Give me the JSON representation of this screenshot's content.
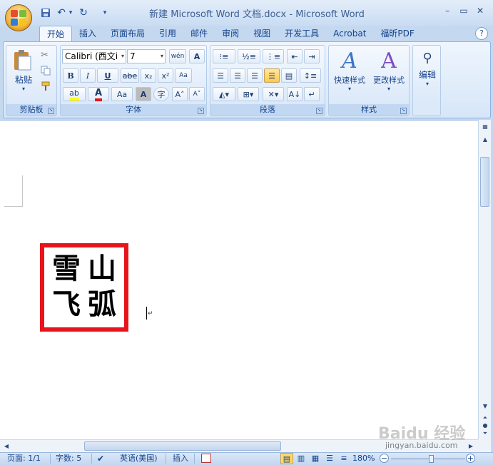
{
  "window": {
    "title": "新建 Microsoft Word 文档.docx - Microsoft Word",
    "minimize": "–",
    "maximize": "▭",
    "close": "✕"
  },
  "qat": {
    "save": "💾",
    "undo": "↶",
    "dropdown": "▾",
    "redo": "↻",
    "customize": "▾"
  },
  "tabs": [
    "开始",
    "插入",
    "页面布局",
    "引用",
    "邮件",
    "审阅",
    "视图",
    "开发工具",
    "Acrobat",
    "福昕PDF"
  ],
  "help": "?",
  "clipboard": {
    "paste_label": "粘贴",
    "group_label": "剪贴板"
  },
  "font": {
    "name": "Calibri (西文i",
    "size": "7",
    "phonetic": "wén",
    "border_char": "A",
    "bold": "B",
    "italic": "I",
    "underline": "U",
    "strike": "abe",
    "subscript": "x₂",
    "superscript": "x²",
    "clear": "Aa",
    "highlight": "ab",
    "color": "A",
    "case": "Aa",
    "shade": "A",
    "enclose": "字",
    "grow": "A˄",
    "shrink": "A˅",
    "group_label": "字体"
  },
  "paragraph": {
    "group_label": "段落"
  },
  "styles": {
    "quick_label": "快速样式",
    "change_label": "更改样式",
    "group_label": "样式"
  },
  "editing": {
    "label": "编辑"
  },
  "document": {
    "seal": [
      "雪",
      "山",
      "飞",
      "弧"
    ],
    "seal_color": "#e8141b"
  },
  "statusbar": {
    "page": "页面: 1/1",
    "words": "字数: 5",
    "language": "英语(美国)",
    "mode": "插入",
    "zoom": "180%"
  },
  "watermark": {
    "brand": "Baidu 经验",
    "url": "jingyan.baidu.com"
  }
}
